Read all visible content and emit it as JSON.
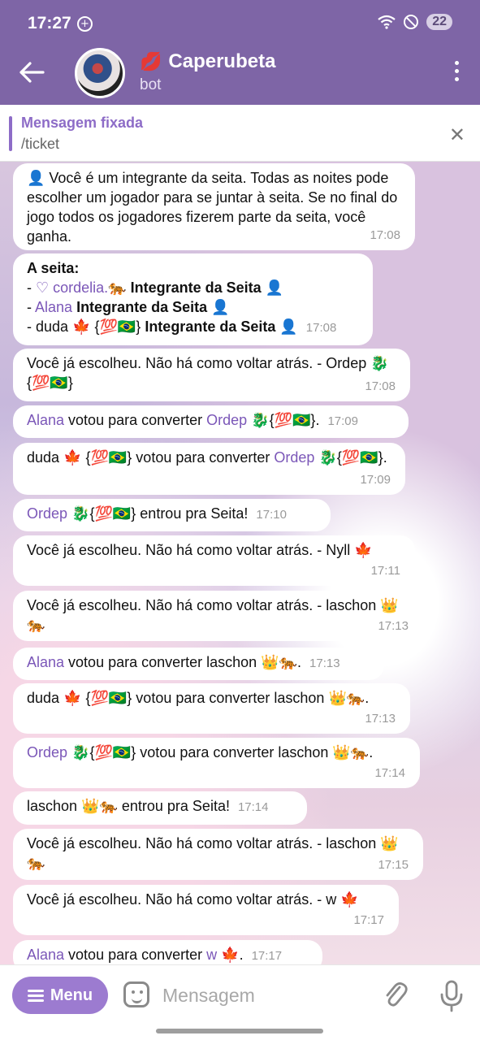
{
  "status_bar": {
    "time": "17:27",
    "battery": "22"
  },
  "header": {
    "title": "Caperubeta",
    "subtitle": "bot",
    "title_emoji": "💋"
  },
  "pinned": {
    "title": "Mensagem fixada",
    "text": "/ticket"
  },
  "messages": [
    {
      "body": "👤 Você é um integrante da seita. Todas as noites pode escolher um jogador para se juntar à seita. Se no final do jogo todos os jogadores fizerem parte da seita, você ganha.",
      "time": "17:08"
    },
    {
      "title": "A seita:",
      "lines": [
        {
          "prefix": "- ",
          "name": "♡ cordelia.🐅",
          "role": " Integrante da Seita 👤"
        },
        {
          "prefix": "- ",
          "name": "Alana",
          "role": " Integrante da Seita 👤"
        },
        {
          "prefix": "- duda 🍁 {💯🇧🇷}",
          "name": "",
          "role": " Integrante da Seita 👤"
        }
      ],
      "time": "17:08"
    },
    {
      "body": "Você já escolheu. Não há como voltar atrás. - Ordep 🐉{💯🇧🇷}",
      "time": "17:08"
    },
    {
      "name": "Alana",
      "text1": " votou para converter ",
      "name2": "Ordep",
      "text2": " 🐉{💯🇧🇷}.",
      "time": "17:09"
    },
    {
      "text0": "duda 🍁 {💯🇧🇷} votou para converter ",
      "name2": "Ordep",
      "text2": " 🐉{💯🇧🇷}.",
      "time": "17:09"
    },
    {
      "name": "Ordep",
      "text1": " 🐉{💯🇧🇷} entrou pra Seita!",
      "time": "17:10"
    },
    {
      "body": "Você já escolheu. Não há como voltar atrás. - Nyll 🍁",
      "time": "17:11"
    },
    {
      "body": "Você já escolheu. Não há como voltar atrás. - laschon 👑🐅",
      "time": "17:13"
    },
    {
      "name": "Alana",
      "text1": " votou para converter laschon 👑🐅.",
      "time": "17:13"
    },
    {
      "body": "duda 🍁 {💯🇧🇷} votou para converter laschon 👑🐅.",
      "time": "17:13"
    },
    {
      "name": "Ordep",
      "text1": " 🐉{💯🇧🇷} votou para converter laschon 👑🐅.",
      "time": "17:14"
    },
    {
      "body": "laschon 👑🐅 entrou pra Seita!",
      "time": "17:14"
    },
    {
      "body": "Você já escolheu. Não há como voltar atrás. - laschon 👑🐅",
      "time": "17:15"
    },
    {
      "body": "Você já escolheu. Não há como voltar atrás. - w 🍁",
      "time": "17:17"
    },
    {
      "name": "Alana",
      "text1": " votou para converter ",
      "name2": "w",
      "text2": " 🍁.",
      "time": "17:17"
    }
  ],
  "input": {
    "menu_label": "Menu",
    "placeholder": "Mensagem"
  },
  "colors": {
    "header": "#7e65a6",
    "accent": "#8d6cc7",
    "menu_button": "#9c7bd0",
    "username": "#7b57b8"
  }
}
